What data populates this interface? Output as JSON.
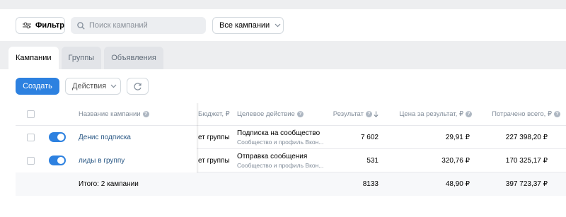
{
  "toolbar": {
    "filter_label": "Фильтр",
    "search_placeholder": "Поиск кампаний",
    "campaign_select_value": "Все кампании"
  },
  "tabs": [
    {
      "label": "Кампании",
      "active": true
    },
    {
      "label": "Группы",
      "active": false
    },
    {
      "label": "Объявления",
      "active": false
    }
  ],
  "actions": {
    "create_label": "Создать",
    "actions_label": "Действия"
  },
  "table": {
    "headers": {
      "name": "Название кампании",
      "budget": "Бюджет, ₽",
      "goal": "Целевое действие",
      "result": "Результат",
      "price": "Цена за результат, ₽",
      "spent": "Потрачено всего, ₽"
    },
    "rows": [
      {
        "name": "Денис подписка",
        "enabled": true,
        "budget": "ет группы",
        "goal": "Подписка на сообщество",
        "goal_sub": "Сообщество и профиль Вкон...",
        "result": "7 602",
        "price": "29,91 ₽",
        "spent": "227 398,20 ₽"
      },
      {
        "name": "лиды в группу",
        "enabled": true,
        "budget": "ет группы",
        "goal": "Отправка сообщения",
        "goal_sub": "Сообщество и профиль Вкон...",
        "result": "531",
        "price": "320,76 ₽",
        "spent": "170 325,17 ₽"
      }
    ],
    "total": {
      "label": "Итого: 2 кампании",
      "result": "8133",
      "price": "48,90 ₽",
      "spent": "397 723,37 ₽"
    }
  },
  "colors": {
    "accent": "#2d81e0",
    "link": "#2a5885",
    "background": "#edeef0"
  },
  "icons": [
    "sliders-icon",
    "search-icon",
    "chevron-down-icon",
    "refresh-icon",
    "help-icon",
    "sort-down-icon"
  ]
}
